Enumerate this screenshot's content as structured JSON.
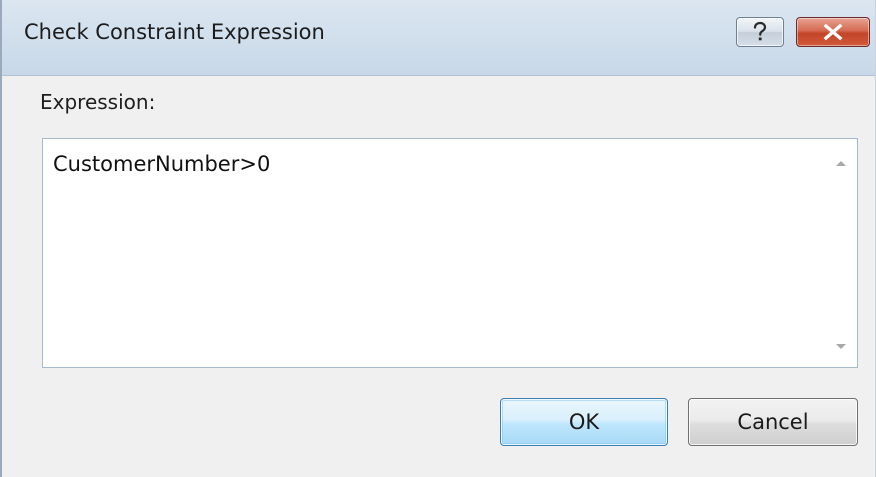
{
  "window": {
    "title": "Check Constraint Expression",
    "help_icon": "question-mark-icon",
    "close_icon": "close-x-icon"
  },
  "form": {
    "expression_label": "Expression:",
    "expression_value": "CustomerNumber>0"
  },
  "buttons": {
    "ok_label": "OK",
    "cancel_label": "Cancel"
  },
  "colors": {
    "titlebar": "#c8d8e8",
    "close_button": "#c24528",
    "ok_button_border": "#3c7fb1",
    "dialog_background": "#f0f0f0"
  }
}
